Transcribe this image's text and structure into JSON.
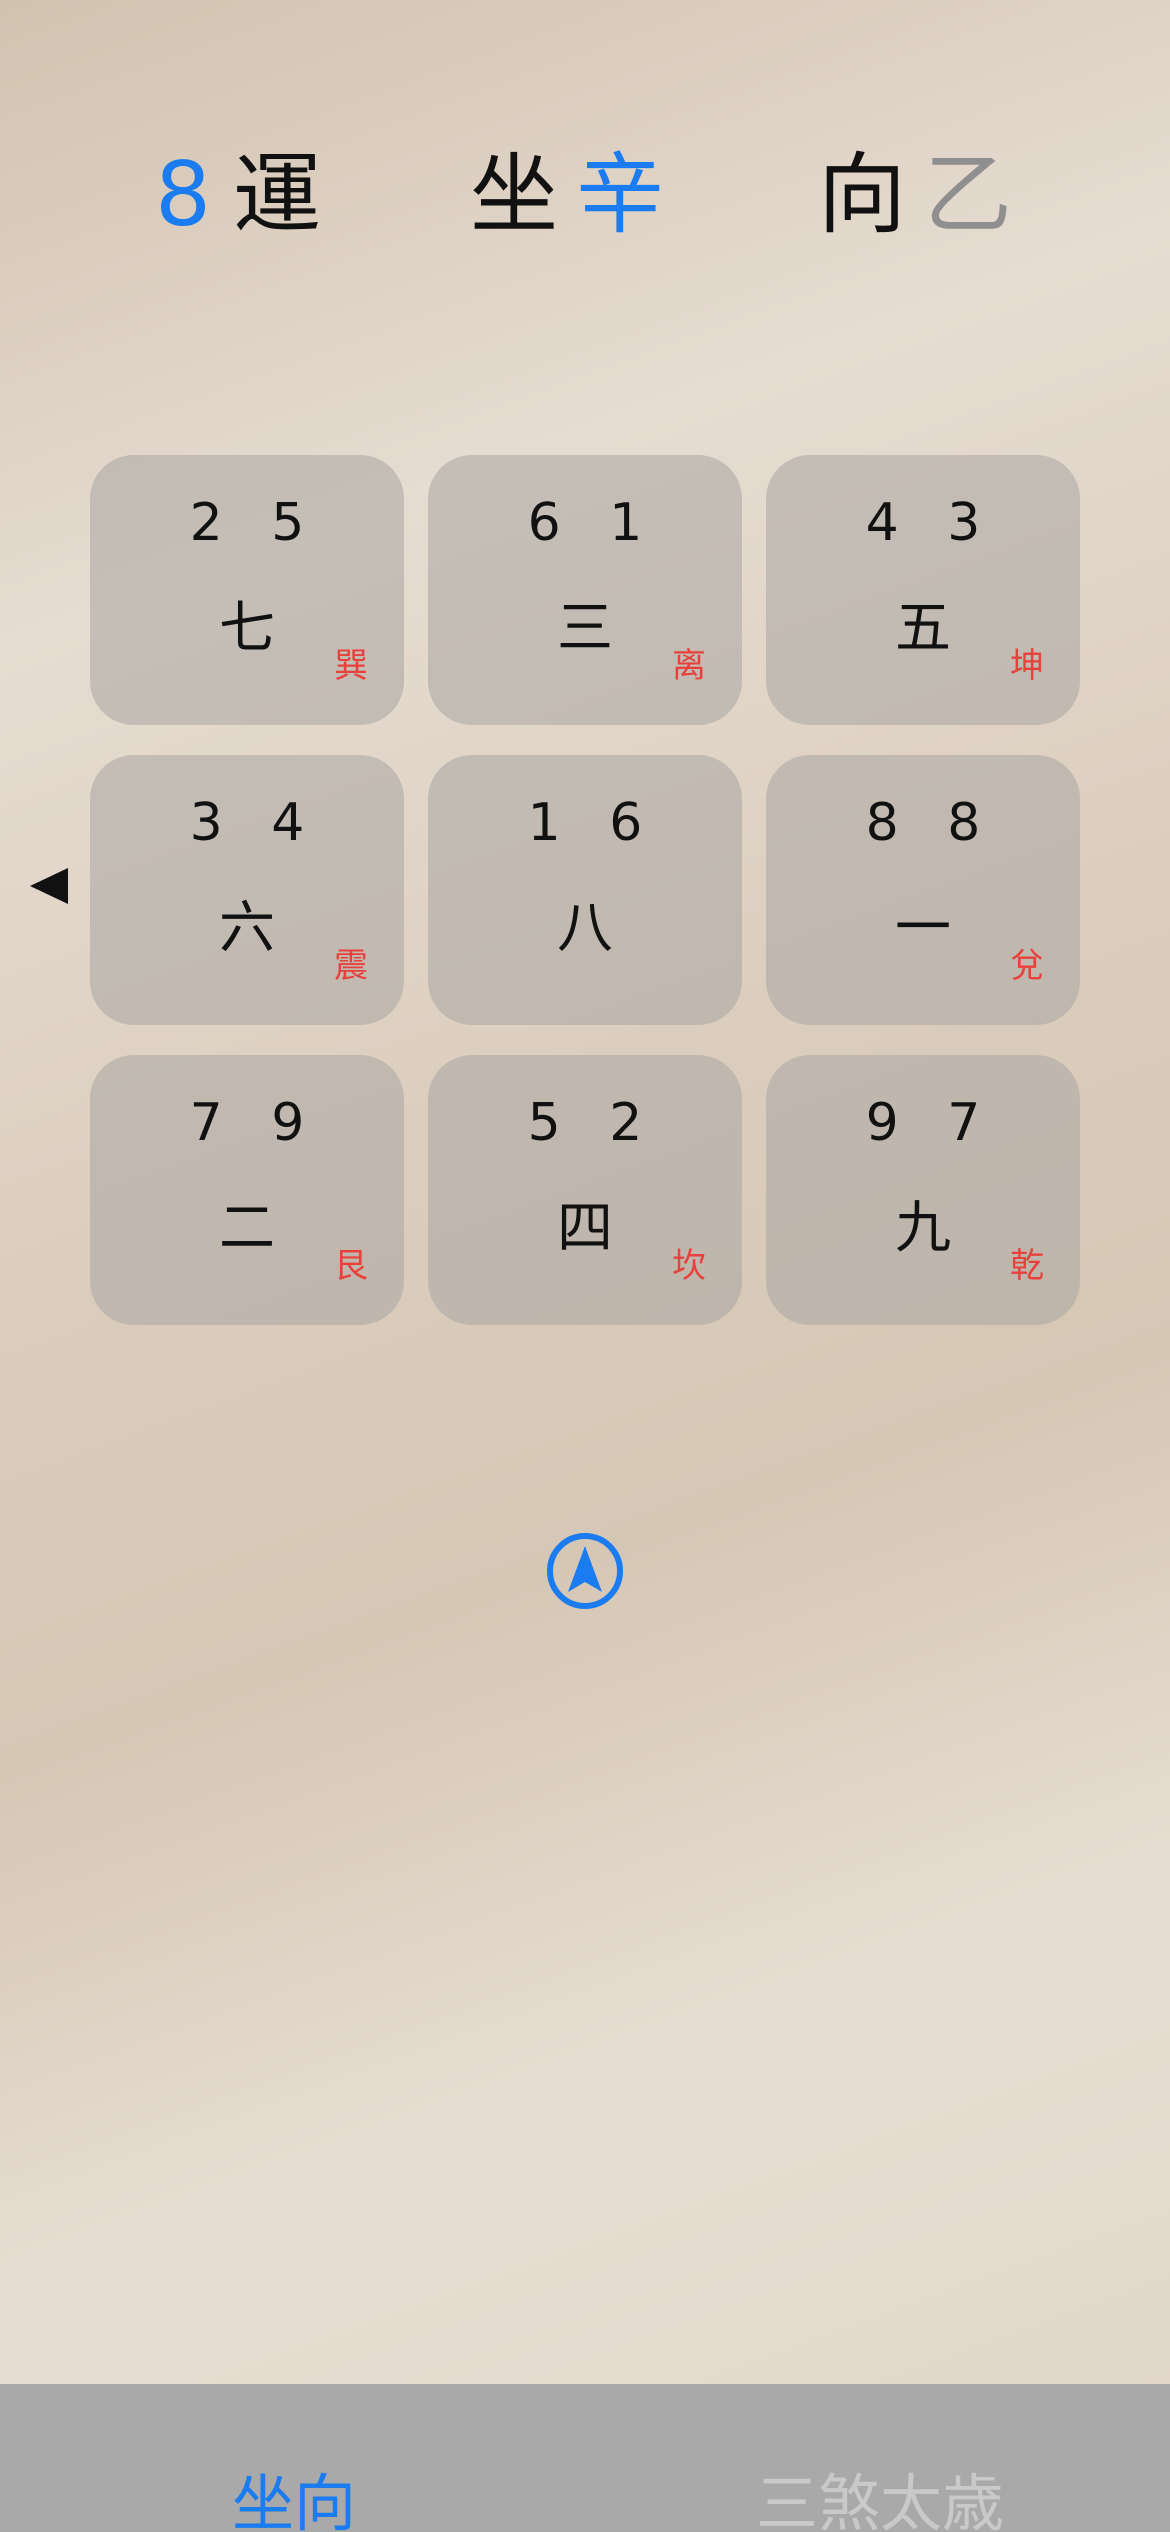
{
  "header": {
    "period_number": "8",
    "period_label": "運",
    "sit_label": "坐",
    "sit_value": "辛",
    "face_label": "向",
    "face_value": "乙"
  },
  "grid": {
    "cells": [
      {
        "nums": "2 5",
        "star": "七",
        "gua": "巽"
      },
      {
        "nums": "6 1",
        "star": "三",
        "gua": "离"
      },
      {
        "nums": "4 3",
        "star": "五",
        "gua": "坤"
      },
      {
        "nums": "3 4",
        "star": "六",
        "gua": "震"
      },
      {
        "nums": "1 6",
        "star": "八",
        "gua": ""
      },
      {
        "nums": "8 8",
        "star": "一",
        "gua": "兌"
      },
      {
        "nums": "7 9",
        "star": "二",
        "gua": "艮"
      },
      {
        "nums": "5 2",
        "star": "四",
        "gua": "坎"
      },
      {
        "nums": "9 7",
        "star": "九",
        "gua": "乾"
      }
    ]
  },
  "icons": {
    "side_arrow": "left-triangle-icon",
    "location": "location-arrow-icon"
  },
  "tabbar": {
    "tabs": [
      {
        "label": "坐向",
        "active": true
      },
      {
        "label": "三煞太歳",
        "active": false
      }
    ]
  },
  "colors": {
    "accent": "#1a7cf0",
    "gua_red": "#e8413c",
    "inactive_grey": "#8f8f8f",
    "tabbar_bg": "#a9a9a9"
  }
}
